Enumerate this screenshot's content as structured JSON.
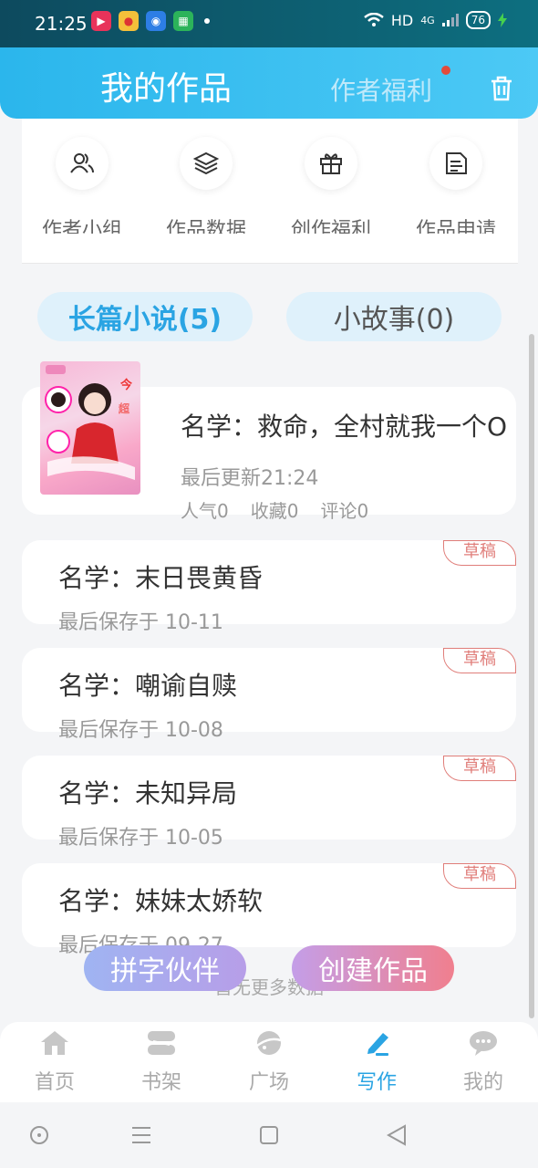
{
  "status": {
    "time": "21:25",
    "network": "HD",
    "signal": "4G",
    "battery": "76"
  },
  "header": {
    "title": "我的作品",
    "perk_label": "作者福利"
  },
  "quick_actions": [
    {
      "label": "作者小组",
      "icon": "group-icon"
    },
    {
      "label": "作品数据",
      "icon": "layers-icon"
    },
    {
      "label": "创作福利",
      "icon": "gift-icon"
    },
    {
      "label": "作品申请",
      "icon": "document-icon"
    }
  ],
  "tabs": [
    {
      "label": "长篇小说(5)",
      "active": true
    },
    {
      "label": "小故事(0)",
      "active": false
    }
  ],
  "works": [
    {
      "name": "名学：救命，全村就我一个O",
      "updated": "最后更新21:24",
      "stats": [
        "人气0",
        "收藏0",
        "评论0"
      ],
      "draft": false
    },
    {
      "name": "名学：末日畏黄昏",
      "updated": "最后保存于 10-11",
      "draft": true,
      "draft_label": "草稿"
    },
    {
      "name": "名学：嘲谕自赎",
      "updated": "最后保存于 10-08",
      "draft": true,
      "draft_label": "草稿"
    },
    {
      "name": "名学：未知异局",
      "updated": "最后保存于 10-05",
      "draft": true,
      "draft_label": "草稿"
    },
    {
      "name": "名学：妹妹太娇软",
      "updated": "最后保存于 09-27",
      "draft": true,
      "draft_label": "草稿"
    }
  ],
  "no_more": "暂无更多数据",
  "fab": {
    "partner": "拼字伙伴",
    "create": "创建作品"
  },
  "nav": [
    {
      "label": "首页",
      "icon": "home-icon"
    },
    {
      "label": "书架",
      "icon": "bookshelf-icon"
    },
    {
      "label": "广场",
      "icon": "planet-icon"
    },
    {
      "label": "写作",
      "icon": "pen-icon",
      "active": true
    },
    {
      "label": "我的",
      "icon": "chat-icon"
    }
  ],
  "colors": {
    "accent": "#2aa4e3",
    "header": "#2bb6ec",
    "draft": "#e07e7a"
  }
}
